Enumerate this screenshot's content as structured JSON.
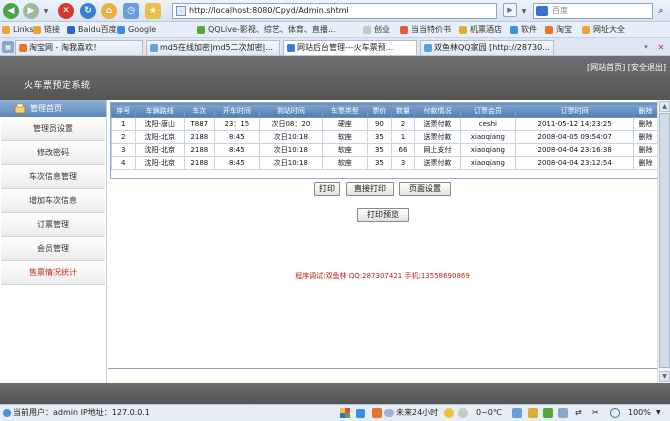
{
  "browser": {
    "address": "http://localhost:8080/Cpyd/Admin.shtml",
    "search_placeholder": "百度",
    "bookmarks": [
      "Links",
      "链接",
      "Baidu百度",
      "Google",
      "QQLive-影视、综艺、体育、直播...",
      "创业",
      "当当特价书",
      "机票酒店",
      "软件",
      "淘宝",
      "网址大全"
    ],
    "tabs": [
      "淘宝网 - 淘我喜欢！",
      "md5在线加密|md5二次加密|...",
      "网站后台管理---火车票预...",
      "双鱼林QQ家园 [http://28730..."
    ],
    "active_tab": 2
  },
  "app": {
    "title": "火车票预定系统",
    "top_links": {
      "home": "[网站首页]",
      "logout": "[安全退出]"
    }
  },
  "sidebar": {
    "header": "管理首页",
    "items": [
      "管理员设置",
      "修改密码",
      "车次信息管理",
      "增加车次信息",
      "订票管理",
      "会员管理",
      "售票情况统计"
    ],
    "highlighted": 6
  },
  "table": {
    "columns": [
      "序号",
      "车辆路线",
      "车次",
      "开车时间",
      "到站时间",
      "车票类型",
      "票价",
      "数量",
      "付款情况",
      "订票会员",
      "订票时间",
      "删除"
    ],
    "rows": [
      [
        "1",
        "沈阳-唐山",
        "T887",
        "23：15",
        "次日08：20",
        "硬座",
        "90",
        "2",
        "送票付款",
        "ceshi",
        "2011-05-12 14:23:25",
        "删除"
      ],
      [
        "2",
        "沈阳-北京",
        "2188",
        "8:45",
        "次日10:18",
        "软座",
        "35",
        "1",
        "送票付款",
        "xiaoqiang",
        "2008-04-05 09:54:07",
        "删除"
      ],
      [
        "3",
        "沈阳-北京",
        "2188",
        "8:45",
        "次日10:18",
        "软座",
        "35",
        "66",
        "网上支付",
        "xiaoqiang",
        "2008-04-04 23:16:38",
        "删除"
      ],
      [
        "4",
        "沈阳-北京",
        "2188",
        "8:45",
        "次日10:18",
        "软座",
        "35",
        "3",
        "送票付款",
        "xiaoqiang",
        "2008-04-04 23:12:54",
        "删除"
      ]
    ]
  },
  "buttons": {
    "print": "打印",
    "direct_print": "直接打印",
    "page_setup": "页面设置",
    "print_preview": "打印预览"
  },
  "footer_note": "程序调试:双鱼林 QQ:287307421 手机:13558690869",
  "statusbar": {
    "left": "当前用户：admin  IP地址：127.0.0.1",
    "weather": "未来24小时",
    "temp": "0~0℃",
    "zoom": "100%"
  },
  "colors": {
    "header": "#5f5f5f",
    "grid_header": "#5f8bbf",
    "accent_red": "#c01a10"
  }
}
